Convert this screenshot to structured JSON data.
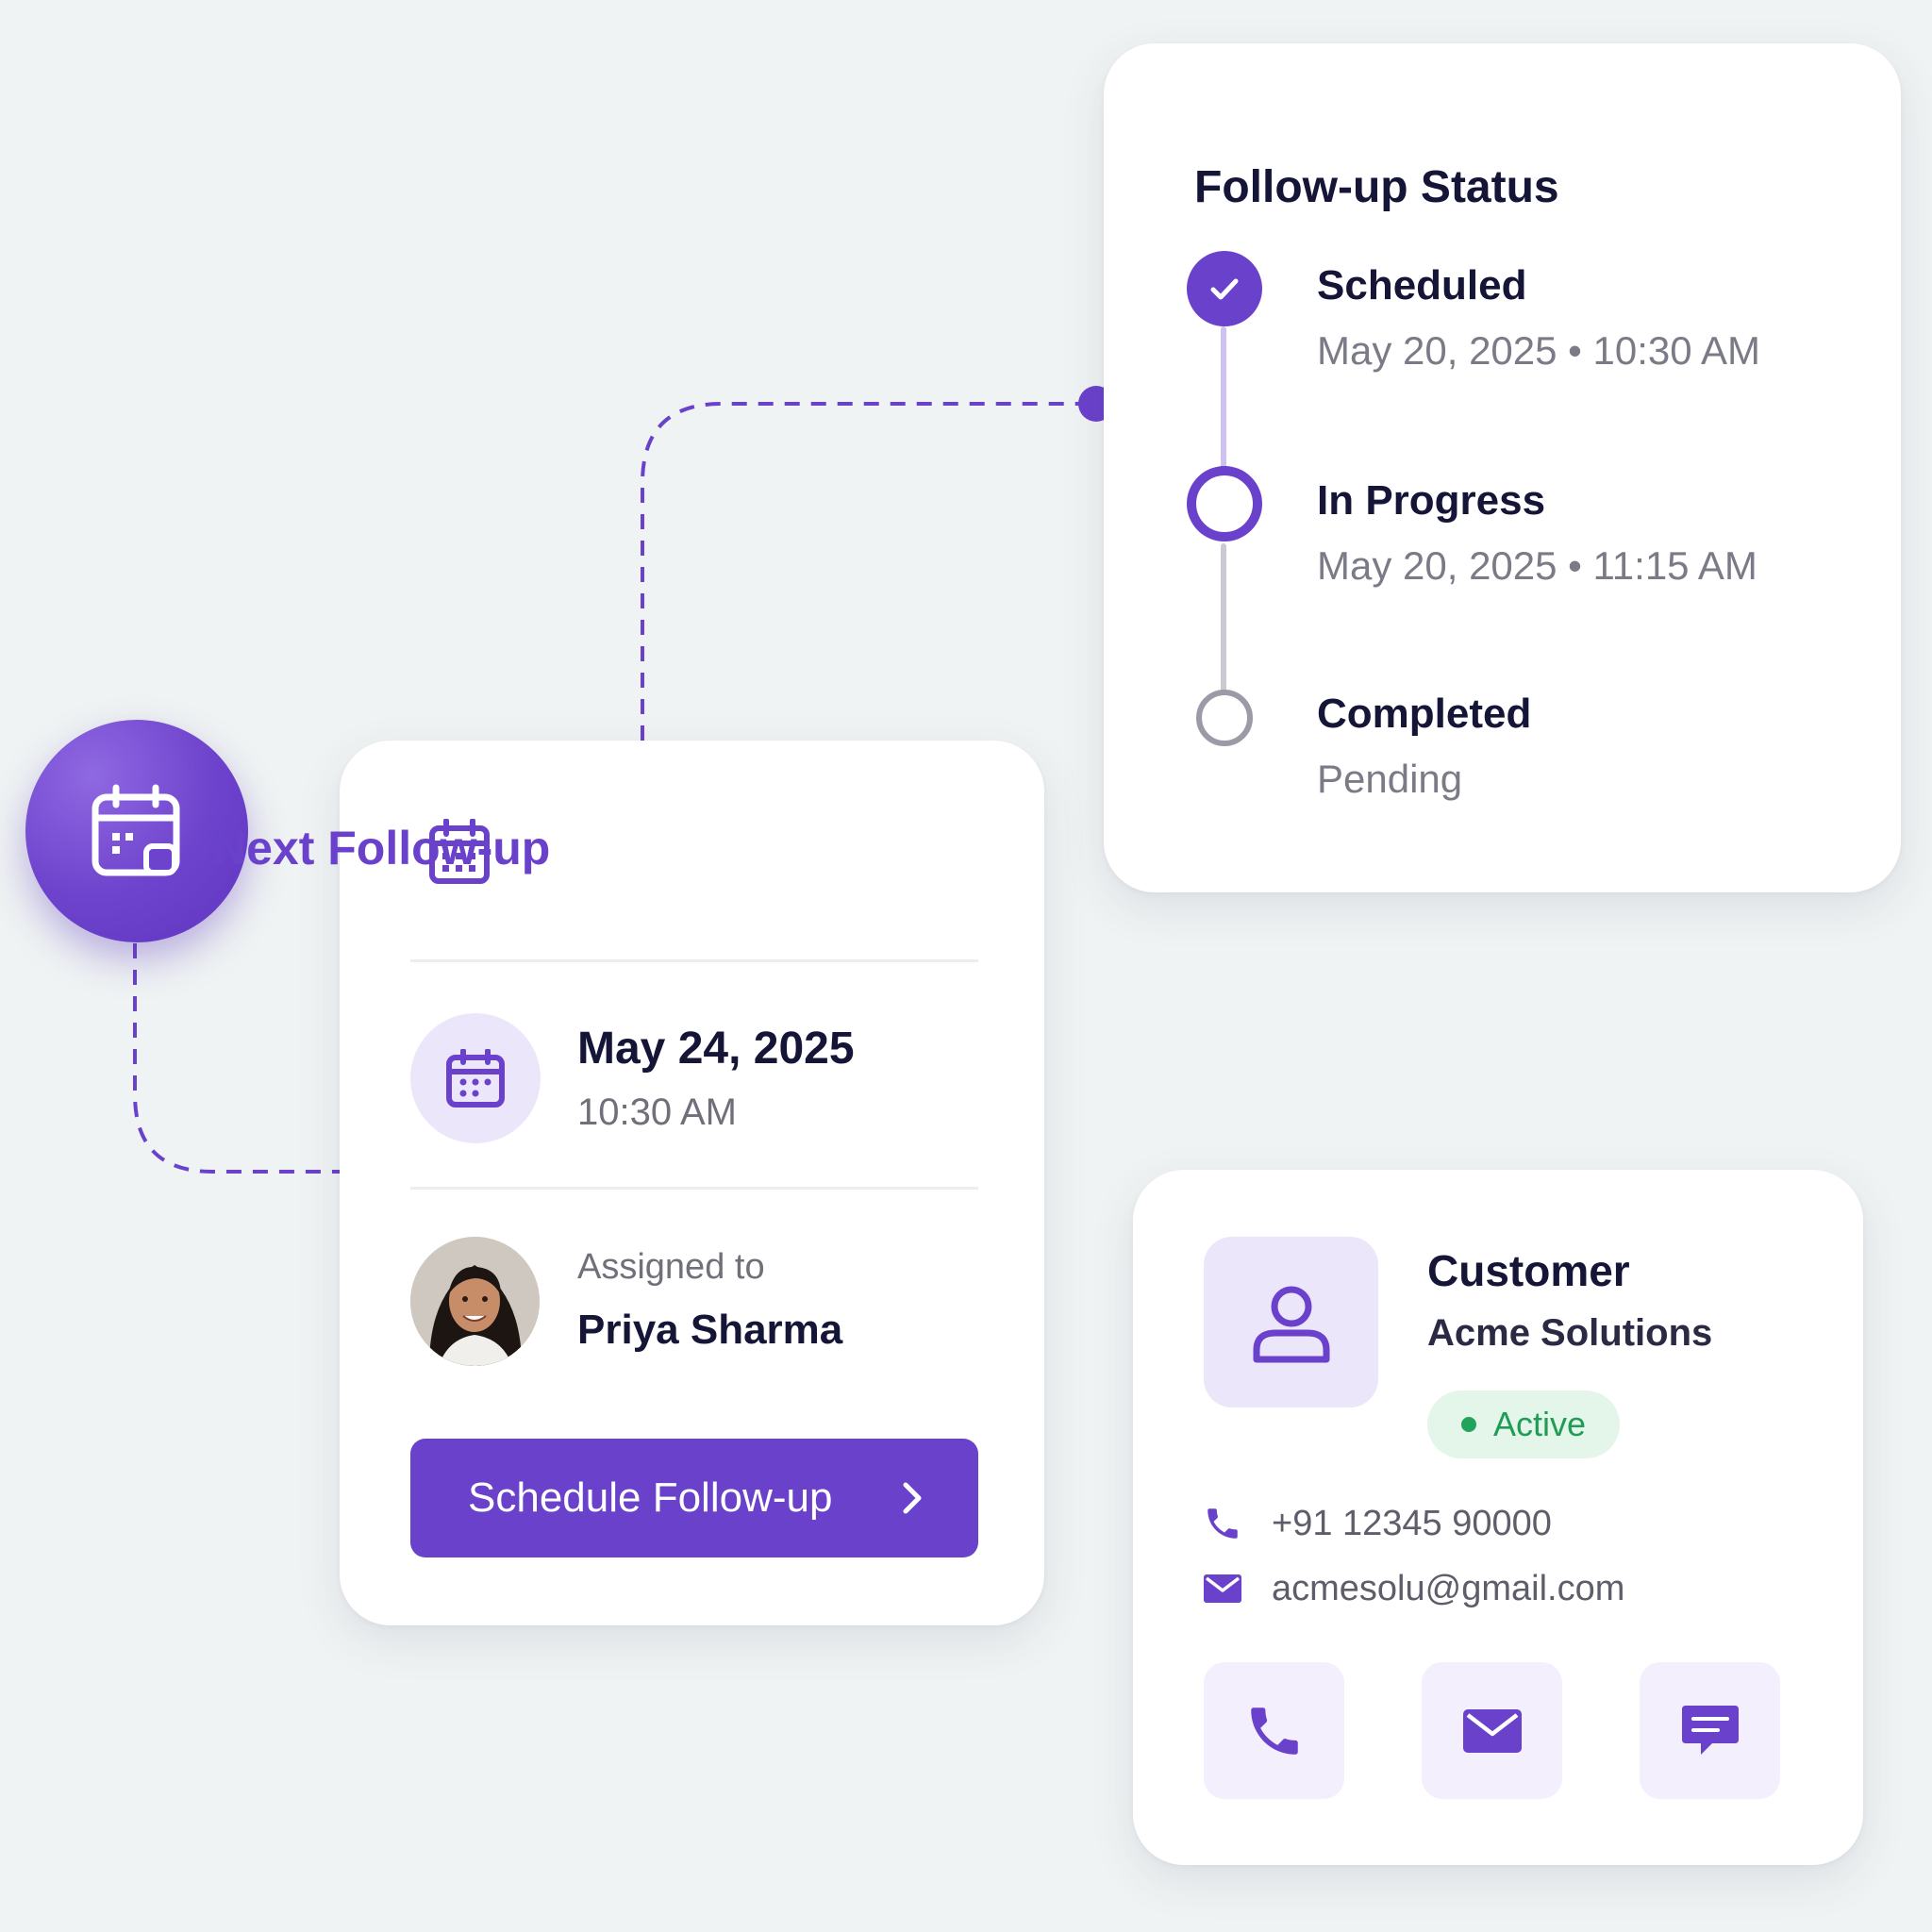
{
  "status": {
    "title": "Follow-up Status",
    "steps": [
      {
        "label": "Scheduled",
        "detail": "May 20, 2025 • 10:30 AM",
        "state": "done"
      },
      {
        "label": "In Progress",
        "detail": "May 20, 2025 • 11:15 AM",
        "state": "current"
      },
      {
        "label": "Completed",
        "detail": "Pending",
        "state": "pending"
      }
    ]
  },
  "followup": {
    "title": "Next Follow-up",
    "date": "May 24, 2025",
    "time": "10:30 AM",
    "assigned_label": "Assigned to",
    "assignee": "Priya Sharma",
    "button_label": "Schedule Follow-up"
  },
  "customer": {
    "title": "Customer",
    "company": "Acme Solutions",
    "status": "Active",
    "phone": "+91 12345 90000",
    "email": "acmesolu@gmail.com",
    "actions": [
      "phone-icon",
      "mail-icon",
      "chat-icon"
    ]
  },
  "colors": {
    "accent": "#6a41cb",
    "accent_light": "#ece6fb",
    "active_green": "#1f9d55",
    "background": "#eff3f3"
  }
}
